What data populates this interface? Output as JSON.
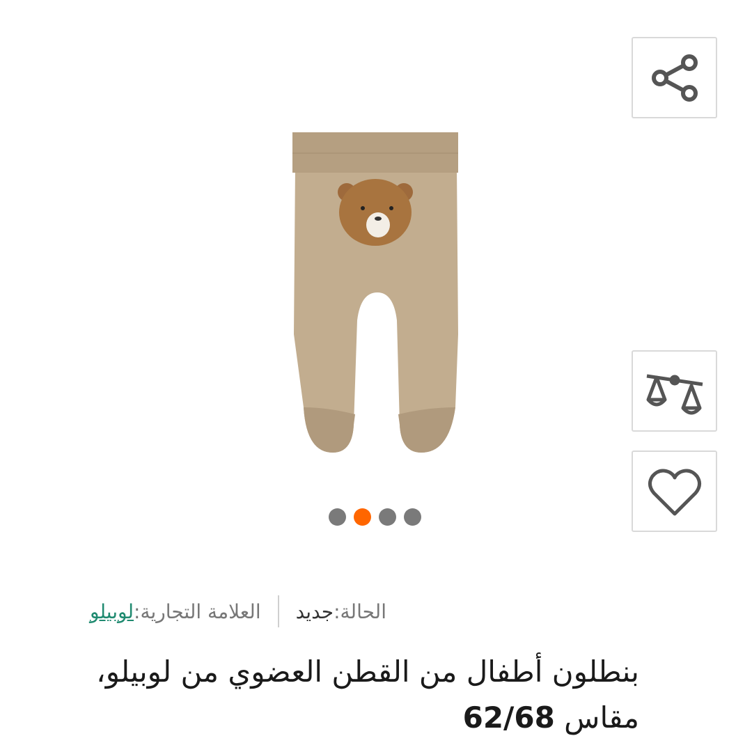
{
  "product": {
    "image_alt": "بنطلون أطفال بني مع رسم دب",
    "gallery": {
      "count": 4,
      "active_index": 1
    },
    "meta": {
      "condition_label": "الحالة:",
      "condition_value": "جديد",
      "brand_label": "العلامة التجارية:",
      "brand_value": "لوبيلو"
    },
    "title": "بنطلون أطفال من القطن العضوي من لوبيلو،",
    "title_size_prefix": "مقاس ",
    "title_size_value": "62/68"
  },
  "actions": {
    "share_icon": "share-icon",
    "compare_icon": "compare-scale-icon",
    "wishlist_icon": "heart-icon"
  },
  "colors": {
    "accent": "#ff6600",
    "brand_link": "#1f8a70",
    "dot_inactive": "#7a7a7a",
    "fabric": "#c2ad8f"
  }
}
